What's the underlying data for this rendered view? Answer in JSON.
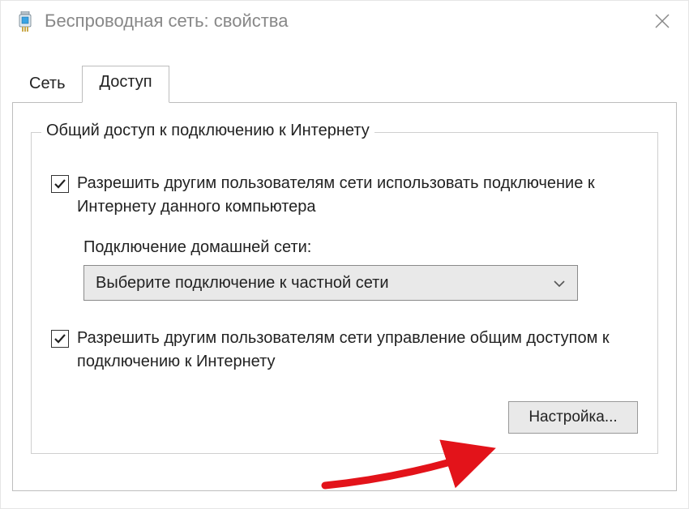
{
  "window": {
    "title": "Беспроводная сеть: свойства",
    "icon": "network-adapter-icon"
  },
  "tabs": [
    {
      "label": "Сеть",
      "active": false
    },
    {
      "label": "Доступ",
      "active": true
    }
  ],
  "panel": {
    "groupbox_legend": "Общий доступ к подключению к Интернету",
    "allow_share": {
      "checked": true,
      "label": "Разрешить другим пользователям сети использовать подключение к Интернету данного компьютера"
    },
    "home_connection_label": "Подключение домашней сети:",
    "home_connection_dropdown": {
      "selected": "Выберите подключение к частной сети"
    },
    "allow_control": {
      "checked": true,
      "label": "Разрешить другим пользователям сети управление общим доступом к подключению к Интернету"
    },
    "settings_button": "Настройка..."
  },
  "annotation": {
    "arrow_color": "#e3131a"
  }
}
